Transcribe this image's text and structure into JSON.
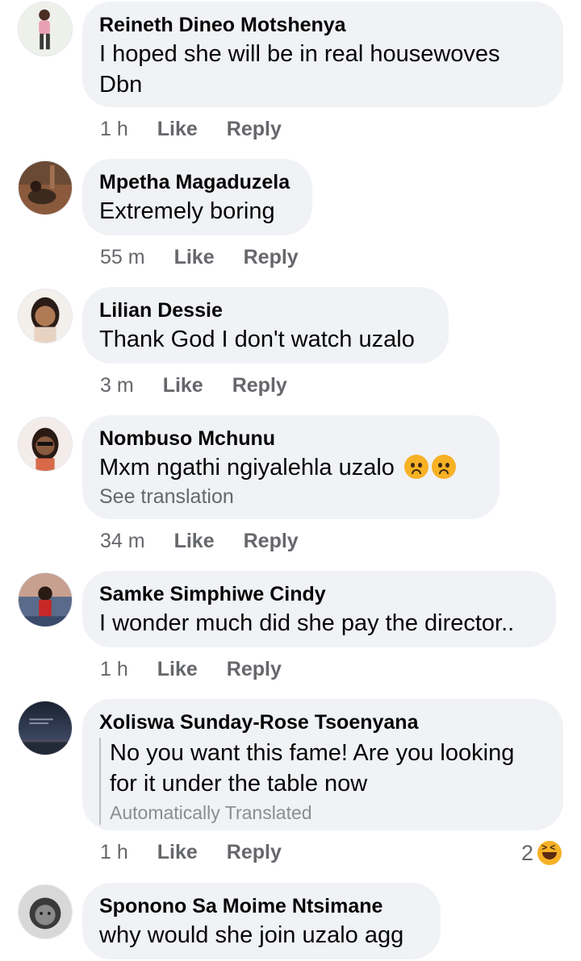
{
  "comments": [
    {
      "author": "Reineth Dineo Motshenya",
      "text": "I hoped she will be in real housewoves Dbn",
      "time": "1 h",
      "like": "Like",
      "reply": "Reply"
    },
    {
      "author": "Mpetha Magaduzela",
      "text": "Extremely boring",
      "time": "55 m",
      "like": "Like",
      "reply": "Reply"
    },
    {
      "author": "Lilian Dessie",
      "text": "Thank God I don't watch uzalo",
      "time": "3 m",
      "like": "Like",
      "reply": "Reply"
    },
    {
      "author": "Nombuso Mchunu",
      "text": "Mxm ngathi ngiyalehla uzalo",
      "emoji": "frowning-face-emoji",
      "see_translation": "See translation",
      "time": "34 m",
      "like": "Like",
      "reply": "Reply"
    },
    {
      "author": "Samke Simphiwe Cindy",
      "text": "I wonder much did she pay the director..",
      "time": "1 h",
      "like": "Like",
      "reply": "Reply"
    },
    {
      "author": "Xoliswa Sunday-Rose Tsoenyana",
      "text": "No you want this fame! Are you looking for it under the table now",
      "translated_label": "Automatically Translated",
      "time": "1 h",
      "like": "Like",
      "reply": "Reply",
      "reaction_count": "2",
      "reaction_icon": "laughing-emoji"
    },
    {
      "author": "Sponono Sa Moime Ntsimane",
      "text": "why would she join uzalo agg"
    }
  ],
  "colors": {
    "bubble": "#f0f2f5",
    "meta": "#65676b",
    "text": "#050505"
  }
}
